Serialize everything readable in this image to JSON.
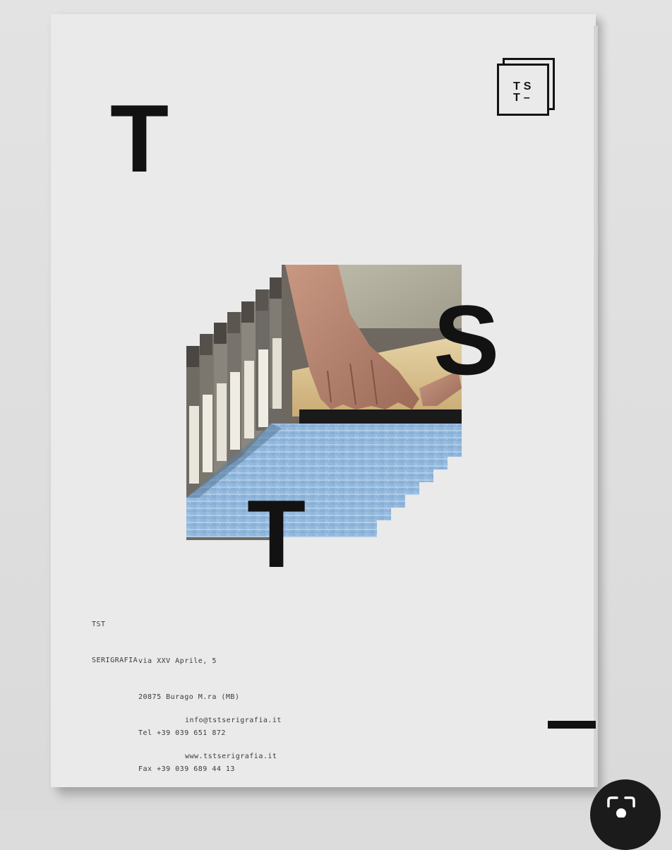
{
  "poster": {
    "big_letters": [
      "T",
      "S",
      "T"
    ],
    "logo_lines": [
      "TS",
      "T–"
    ]
  },
  "info": {
    "brand_lines": [
      "TST",
      "SERIGRAFIA"
    ],
    "address_lines": [
      "via XXV Aprile, 5",
      "20875 Burago M.ra (MB)",
      "Tel +39 039 651 872",
      "Fax +39 039 689 44 13"
    ],
    "web_lines": [
      "info@tstserigrafia.it",
      "www.tstserigrafia.it"
    ]
  },
  "overlay": {
    "icon": "lens-search-icon"
  },
  "colors": {
    "ink": "#121212",
    "paper": "#eaeaea",
    "screen_blue": "#8fb6dc"
  }
}
